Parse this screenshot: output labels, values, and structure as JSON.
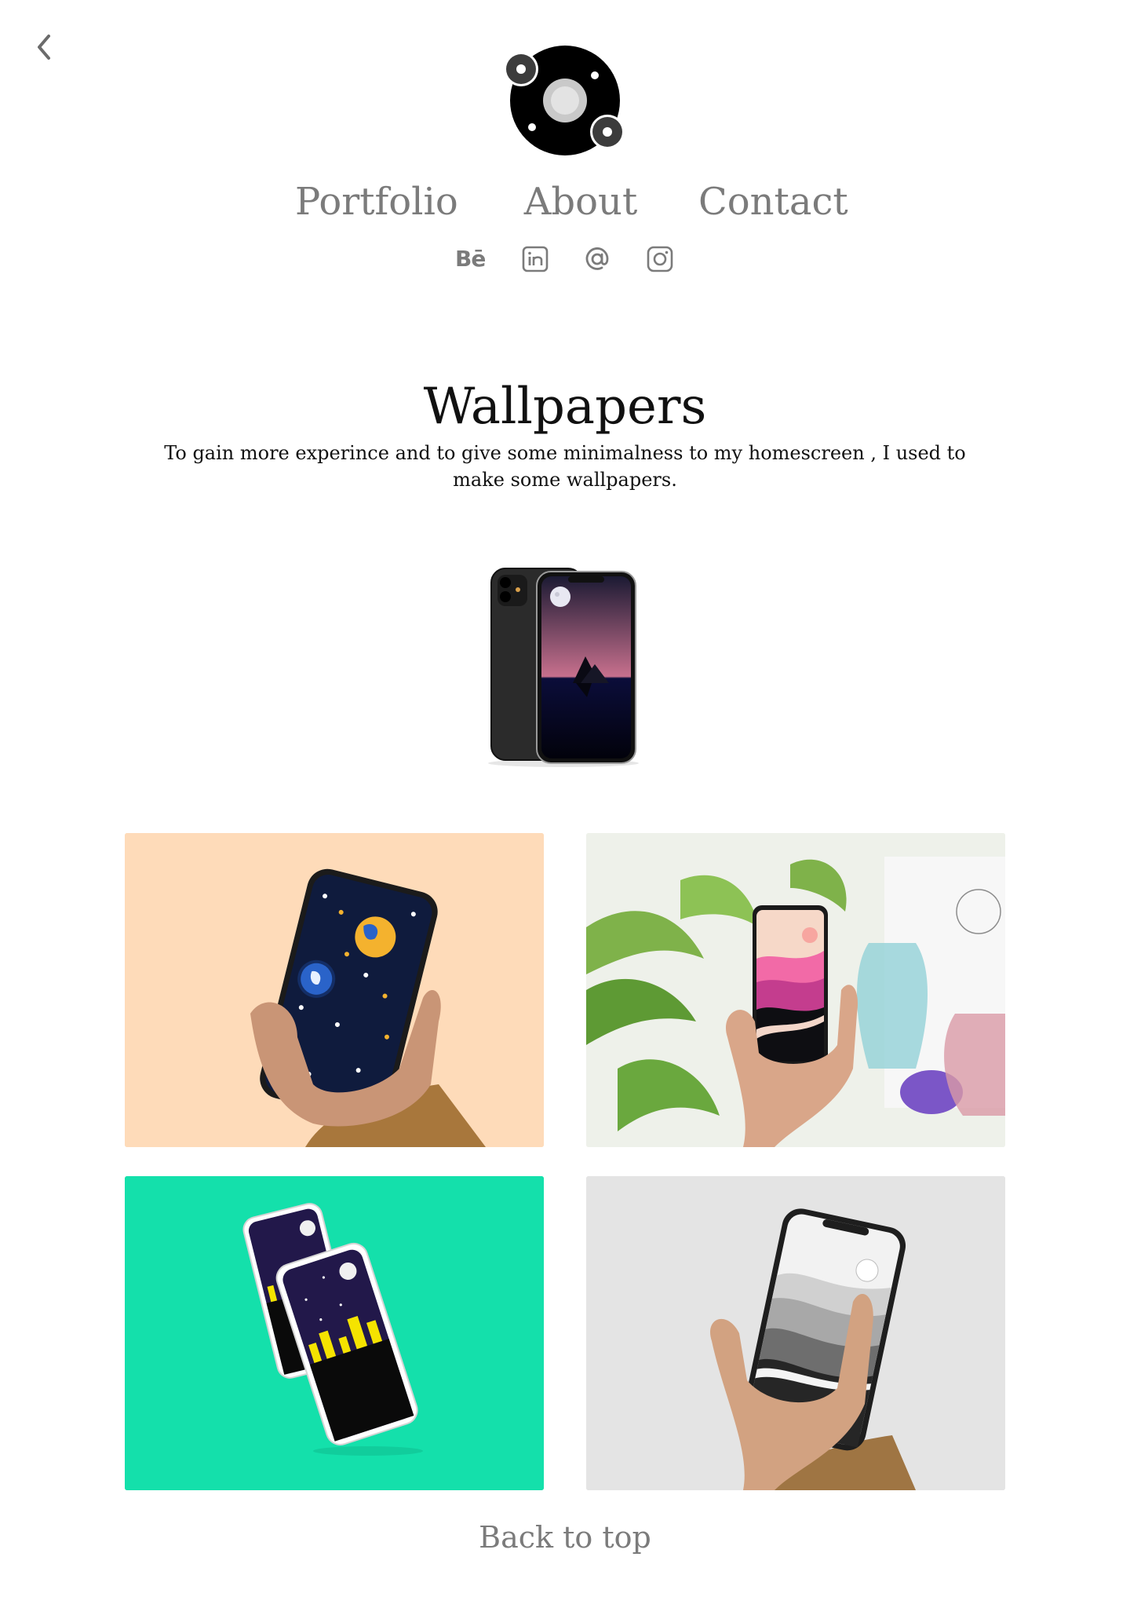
{
  "header": {
    "back_icon": "chevron-left-icon",
    "logo_icon": "orbit-logo-icon"
  },
  "nav": {
    "items": [
      {
        "label": "Portfolio"
      },
      {
        "label": "About"
      },
      {
        "label": "Contact"
      }
    ]
  },
  "social": {
    "behance_label": "Bē",
    "icons": [
      "behance-icon",
      "linkedin-icon",
      "email-icon",
      "instagram-icon"
    ]
  },
  "main": {
    "title": "Wallpapers",
    "description": "To gain more experince and to give some minimalness to my homescreen , I used to make some wallpapers."
  },
  "gallery": {
    "tiles": [
      {
        "name": "space-wallpaper-mockup",
        "background": "#fedbb9"
      },
      {
        "name": "pink-mountains-wallpaper-mockup",
        "background": "#e9ece6"
      },
      {
        "name": "night-city-wallpaper-mockup",
        "background": "#14e0ab"
      },
      {
        "name": "grayscale-mountains-wallpaper-mockup",
        "background": "#e4e4e4"
      }
    ]
  },
  "footer": {
    "back_to_top": "Back to top"
  },
  "colors": {
    "nav_text": "#7b7b7b",
    "title_text": "#111111",
    "accent_green": "#14e0ab",
    "accent_peach": "#fedbb9"
  }
}
